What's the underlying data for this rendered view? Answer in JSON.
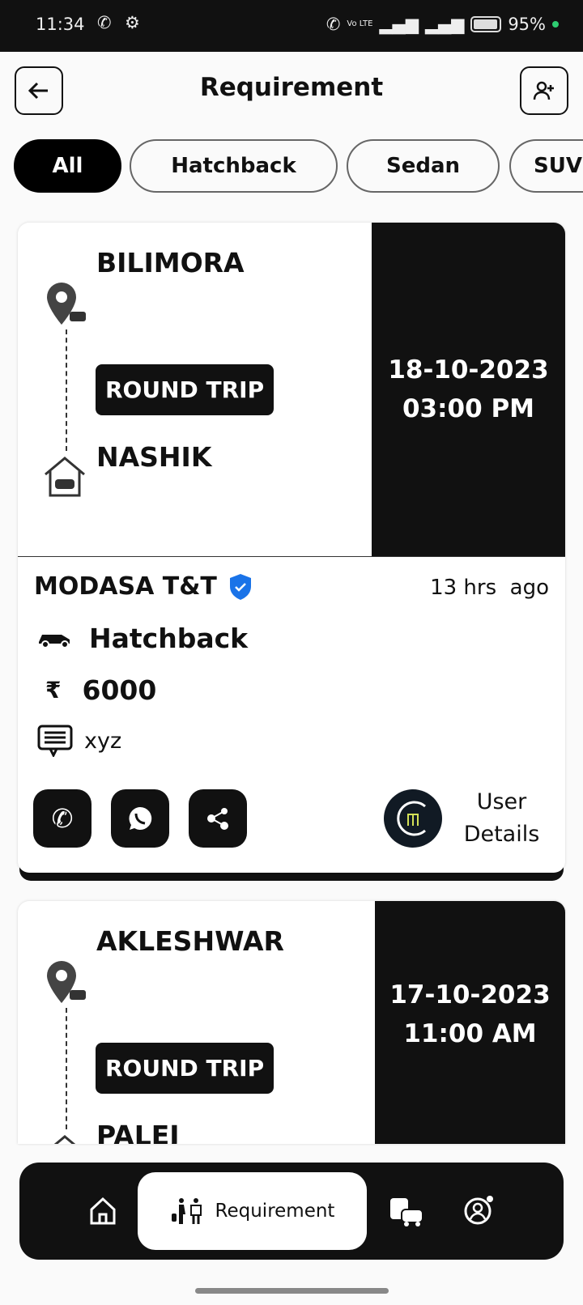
{
  "status": {
    "time": "11:34",
    "battery": "95%",
    "net": "Vo LTE"
  },
  "header": {
    "title": "Requirement"
  },
  "filters": [
    {
      "label": "All",
      "active": true
    },
    {
      "label": "Hatchback"
    },
    {
      "label": "Sedan"
    },
    {
      "label": "SUV"
    }
  ],
  "cards": [
    {
      "from": "BILIMORA",
      "trip_type": "ROUND TRIP",
      "to": "NASHIK",
      "date": "18-10-2023",
      "time": "03:00 PM",
      "agency": "MODASA T&T",
      "posted": "13 hrs  ago",
      "car_type": "Hatchback",
      "price": "6000",
      "currency": "₹",
      "note": "xyz",
      "user_details": "User Details",
      "verified_color": "#1a73e8"
    },
    {
      "from": "AKLESHWAR",
      "trip_type": "ROUND TRIP",
      "to": "PALEJ",
      "date": "17-10-2023",
      "time": "11:00 AM"
    }
  ],
  "nav": {
    "active_label": "Requirement",
    "items": [
      "home-icon",
      "requirement-icon",
      "vehicles-icon",
      "profile-settings-icon"
    ]
  }
}
